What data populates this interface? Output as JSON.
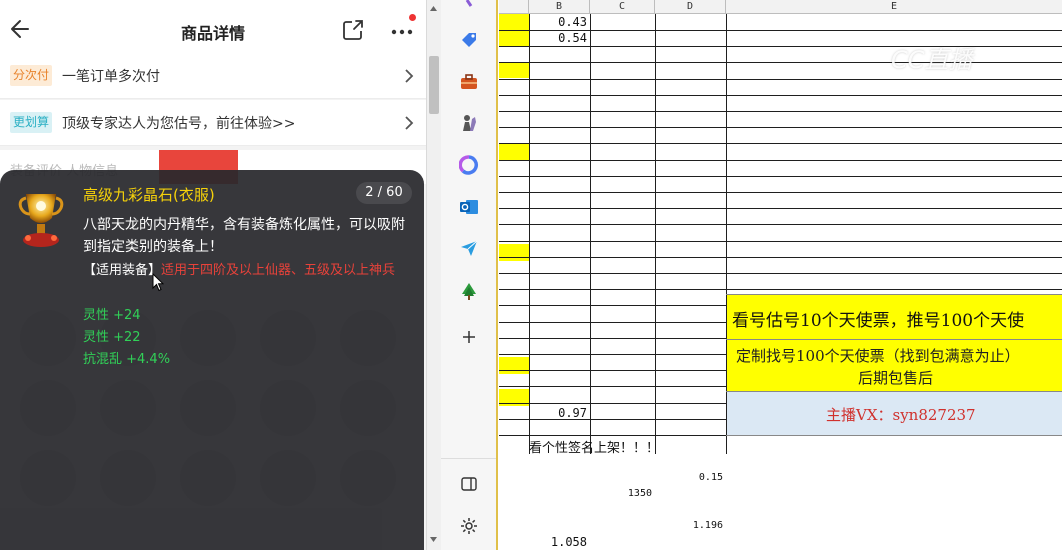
{
  "phone": {
    "title": "商品详情",
    "rows": [
      {
        "tag": "分次付",
        "text": "一笔订单多次付",
        "tag_bg": "#fdebd6",
        "tag_color": "#e8832b"
      },
      {
        "tag": "更划算",
        "text": "顶级专家达人为您估号，前往体验>>",
        "tag_bg": "#d9f1f5",
        "tag_color": "#2bb0c4"
      }
    ],
    "tabs_hint": "装备评价    人物信息"
  },
  "tooltip": {
    "item_name": "高级九彩晶石(衣服)",
    "page": "2 / 60",
    "description": "八部天龙的内丹精华，含有装备炼化属性，可以吸附到指定类别的装备上！",
    "equip_label": "【适用装备】",
    "equip_value": "适用于四阶及以上仙器、五级及以上神兵",
    "stats": [
      "灵性 +24",
      "灵性 +22",
      "抗混乱 +4.4%"
    ]
  },
  "sidebar": {
    "icons": [
      "tag-icon",
      "toolbox-icon",
      "chess-icon",
      "copilot-icon",
      "outlook-icon",
      "send-icon",
      "tree-icon",
      "plus-icon",
      "sidebar-toggle-icon",
      "settings-icon"
    ]
  },
  "sheet": {
    "columns": [
      "B",
      "C",
      "D",
      "E"
    ],
    "values": {
      "b1": "0.43",
      "b2": "0.54",
      "b3": "0.97",
      "d1": "0.15",
      "c1": "1350",
      "d2": "1.196",
      "b4": "1.058"
    },
    "block1": "看号估号10个天使票，推号100个天使",
    "block2_line1": "定制找号100个天使票（找到包满意为止）",
    "block2_line2": "后期包售后",
    "block3": "主播VX：syn827237",
    "sign": "看个性签名上架！！！",
    "watermark": "CC直播",
    "colors": {
      "yellow": "#ffff00",
      "blue": "#dbe8f4",
      "red": "#d0312d"
    }
  }
}
